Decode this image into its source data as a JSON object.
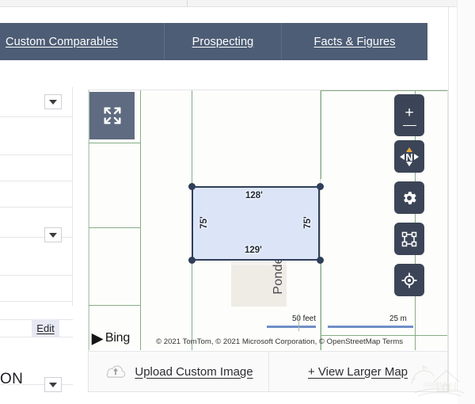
{
  "tabs": [
    {
      "label": "Custom Comparables",
      "name": "tab-custom-comparables"
    },
    {
      "label": "Prospecting",
      "name": "tab-prospecting"
    },
    {
      "label": "Facts & Figures",
      "name": "tab-facts-figures"
    }
  ],
  "sidebar": {
    "edit_label": "Edit",
    "status_label": "ON"
  },
  "map": {
    "street_label": "Ponderosa Dr",
    "provider_logo": "Bing",
    "provider_mark": "▶",
    "attribution": "© 2021 TomTom, © 2021 Microsoft Corporation, © OpenStreetMap  Terms",
    "compass_label": "N",
    "zoom_in": "+",
    "zoom_out": "−",
    "scale": {
      "feet_label": "50 feet",
      "meters_label": "25 m"
    },
    "parcel": {
      "top_dimension": "128'",
      "bottom_dimension": "129'",
      "left_dimension": "75'",
      "right_dimension": "75'",
      "fill_color": "#dbe5f7",
      "stroke_color": "#2f3e59"
    },
    "controls": [
      {
        "name": "zoom-control",
        "icon": "plus-minus-icon"
      },
      {
        "name": "compass-control",
        "icon": "compass-icon"
      },
      {
        "name": "map-settings-control",
        "icon": "gear-icon"
      },
      {
        "name": "draw-shape-control",
        "icon": "shape-icon"
      },
      {
        "name": "locate-me-control",
        "icon": "target-icon"
      }
    ],
    "fullscreen_icon": "expand-icon"
  },
  "footer": {
    "upload_label": "Upload Custom Image",
    "upload_icon": "cloud-upload-icon",
    "larger_map_label": "+ View Larger Map"
  },
  "colors": {
    "tab_bar": "#4d5d75",
    "control_bg": "#3c4557",
    "lot_line": "#86ad86",
    "scale_bar": "#6f8fc7",
    "compass_needle": "#e8a93c"
  }
}
